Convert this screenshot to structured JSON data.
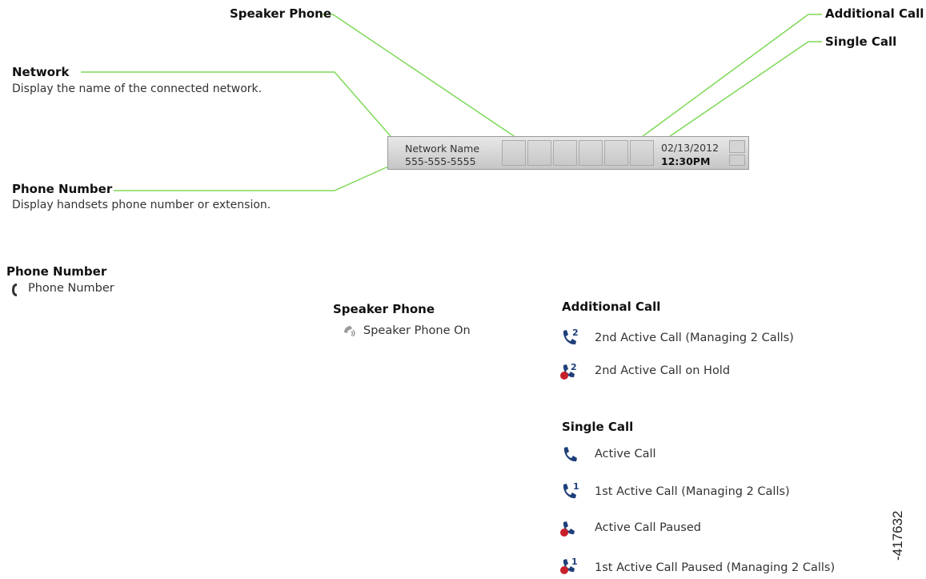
{
  "callouts": {
    "speaker_phone": "Speaker Phone",
    "additional_call": "Additional Call",
    "single_call": "Single Call",
    "network": "Network",
    "network_desc": "Display the name of the connected network.",
    "phone_number": "Phone Number",
    "phone_number_desc": "Display handsets phone number or extension."
  },
  "status_bar": {
    "network_name": "Network Name",
    "phone_number": "555-555-5555",
    "date": "02/13/2012",
    "time": "12:30PM"
  },
  "legend": {
    "phone_number": {
      "title": "Phone Number",
      "items": [
        {
          "icon": "phone-number-icon",
          "label": "Phone Number"
        }
      ]
    },
    "speaker_phone": {
      "title": "Speaker Phone",
      "items": [
        {
          "icon": "speaker-phone-icon",
          "label": "Speaker Phone On"
        }
      ]
    },
    "additional_call": {
      "title": "Additional Call",
      "items": [
        {
          "icon": "active-call-2-icon",
          "label": "2nd Active Call (Managing 2 Calls)"
        },
        {
          "icon": "call-on-hold-2-icon",
          "label": "2nd Active Call on Hold"
        }
      ]
    },
    "single_call": {
      "title": "Single Call",
      "items": [
        {
          "icon": "active-call-icon",
          "label": "Active Call"
        },
        {
          "icon": "active-call-1-icon",
          "label": "1st Active Call (Managing 2 Calls)"
        },
        {
          "icon": "call-paused-icon",
          "label": "Active Call Paused"
        },
        {
          "icon": "call-paused-1-icon",
          "label": "1st Active Call Paused (Managing 2 Calls)"
        }
      ]
    }
  },
  "figure_id": "-417632",
  "colors": {
    "leader_line": "#7ed957",
    "icon_blue": "#1f3f7a",
    "icon_red": "#c8202a"
  }
}
